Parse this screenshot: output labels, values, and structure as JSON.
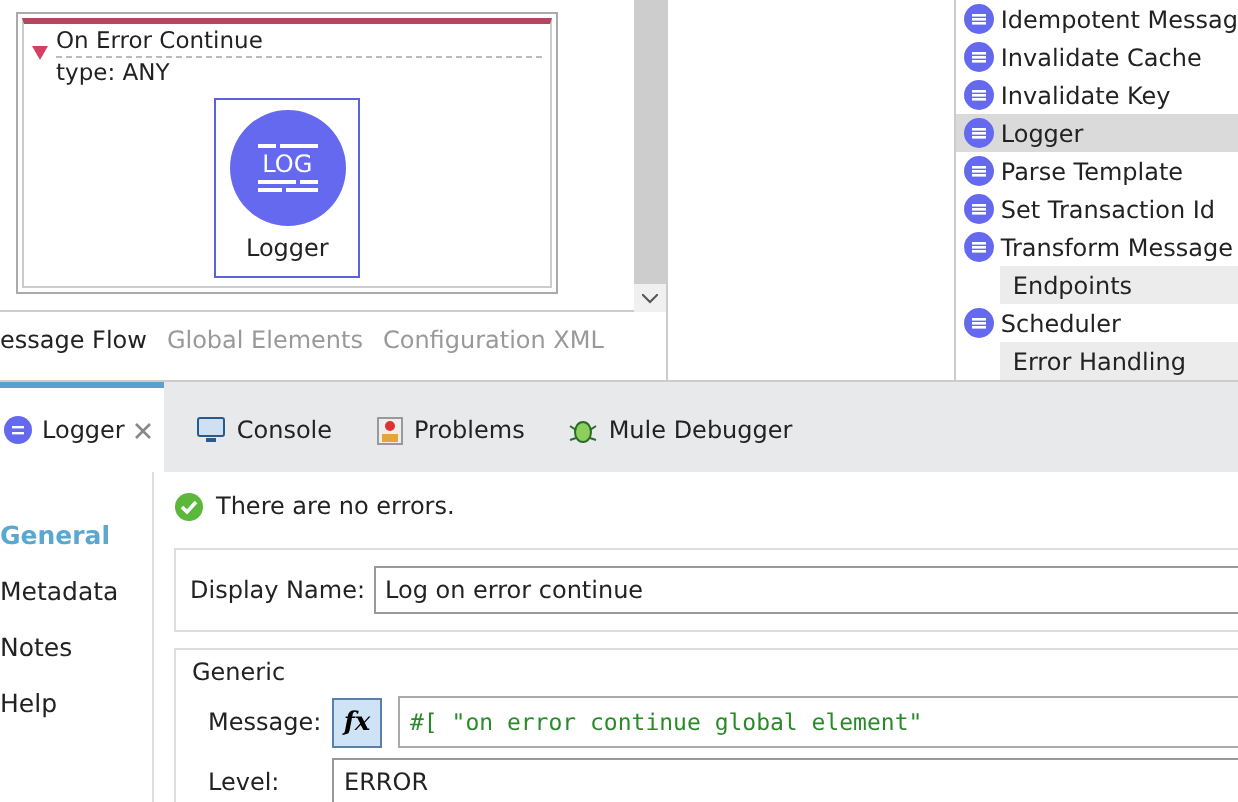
{
  "canvas": {
    "scope": {
      "title": "On Error Continue",
      "subtitle": "type: ANY",
      "expanded": true
    },
    "component": {
      "icon_text": "LOG",
      "label": "Logger",
      "selected": true
    }
  },
  "view_tabs": [
    {
      "label": "essage Flow",
      "selected": true
    },
    {
      "label": "Global Elements",
      "selected": false
    },
    {
      "label": "Configuration XML",
      "selected": false
    }
  ],
  "palette": [
    {
      "kind": "item",
      "label": "Idempotent Messag",
      "selected": false
    },
    {
      "kind": "item",
      "label": "Invalidate Cache",
      "selected": false
    },
    {
      "kind": "item",
      "label": "Invalidate Key",
      "selected": false
    },
    {
      "kind": "item",
      "label": "Logger",
      "selected": true
    },
    {
      "kind": "item",
      "label": "Parse Template",
      "selected": false
    },
    {
      "kind": "item",
      "label": "Set Transaction Id",
      "selected": false
    },
    {
      "kind": "item",
      "label": "Transform Message",
      "selected": false
    },
    {
      "kind": "category",
      "label": "Endpoints"
    },
    {
      "kind": "item",
      "label": "Scheduler",
      "selected": false
    },
    {
      "kind": "category",
      "label": "Error Handling"
    }
  ],
  "bottom_tabs": [
    {
      "label": "Logger",
      "kind": "editor",
      "selected": true
    },
    {
      "label": "Console",
      "kind": "console",
      "selected": false
    },
    {
      "label": "Problems",
      "kind": "problems",
      "selected": false
    },
    {
      "label": "Mule Debugger",
      "kind": "debugger",
      "selected": false
    }
  ],
  "status": "There are no errors.",
  "nav": [
    {
      "label": "General",
      "selected": true
    },
    {
      "label": "Metadata",
      "selected": false
    },
    {
      "label": "Notes",
      "selected": false
    },
    {
      "label": "Help",
      "selected": false
    }
  ],
  "display_name": {
    "label": "Display Name:",
    "value": "Log on error continue"
  },
  "generic": {
    "title": "Generic",
    "message_label": "Message:",
    "fx": "fx",
    "expression_on": true,
    "message_value": "#[ \"on error continue global element\"",
    "level_label": "Level:",
    "level_value": "ERROR"
  }
}
